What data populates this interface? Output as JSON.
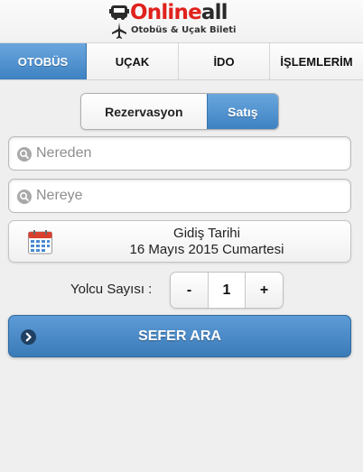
{
  "brand": {
    "name_part1": "Online",
    "name_part2": "all",
    "tagline": "Otobüs & Uçak Bileti",
    "primary_color": "#e0211c",
    "accent_color": "#3e82c2"
  },
  "tabs": [
    {
      "label": "OTOBÜS",
      "active": true
    },
    {
      "label": "UÇAK",
      "active": false
    },
    {
      "label": "İDO",
      "active": false
    },
    {
      "label": "İŞLEMLERİM",
      "active": false
    }
  ],
  "mode_toggle": {
    "options": [
      "Rezervasyon",
      "Satış"
    ],
    "selected": "Satış"
  },
  "from": {
    "placeholder": "Nereden",
    "value": "",
    "icon": "search-icon"
  },
  "to": {
    "placeholder": "Nereye",
    "value": "",
    "icon": "search-icon"
  },
  "date": {
    "label": "Gidiş Tarihi",
    "value": "16 Mayıs 2015 Cumartesi",
    "icon": "calendar-icon"
  },
  "passengers": {
    "label": "Yolcu Sayısı :",
    "minus": "-",
    "plus": "+",
    "count": "1"
  },
  "search": {
    "label": "SEFER ARA",
    "icon": "chevron-right-icon"
  }
}
